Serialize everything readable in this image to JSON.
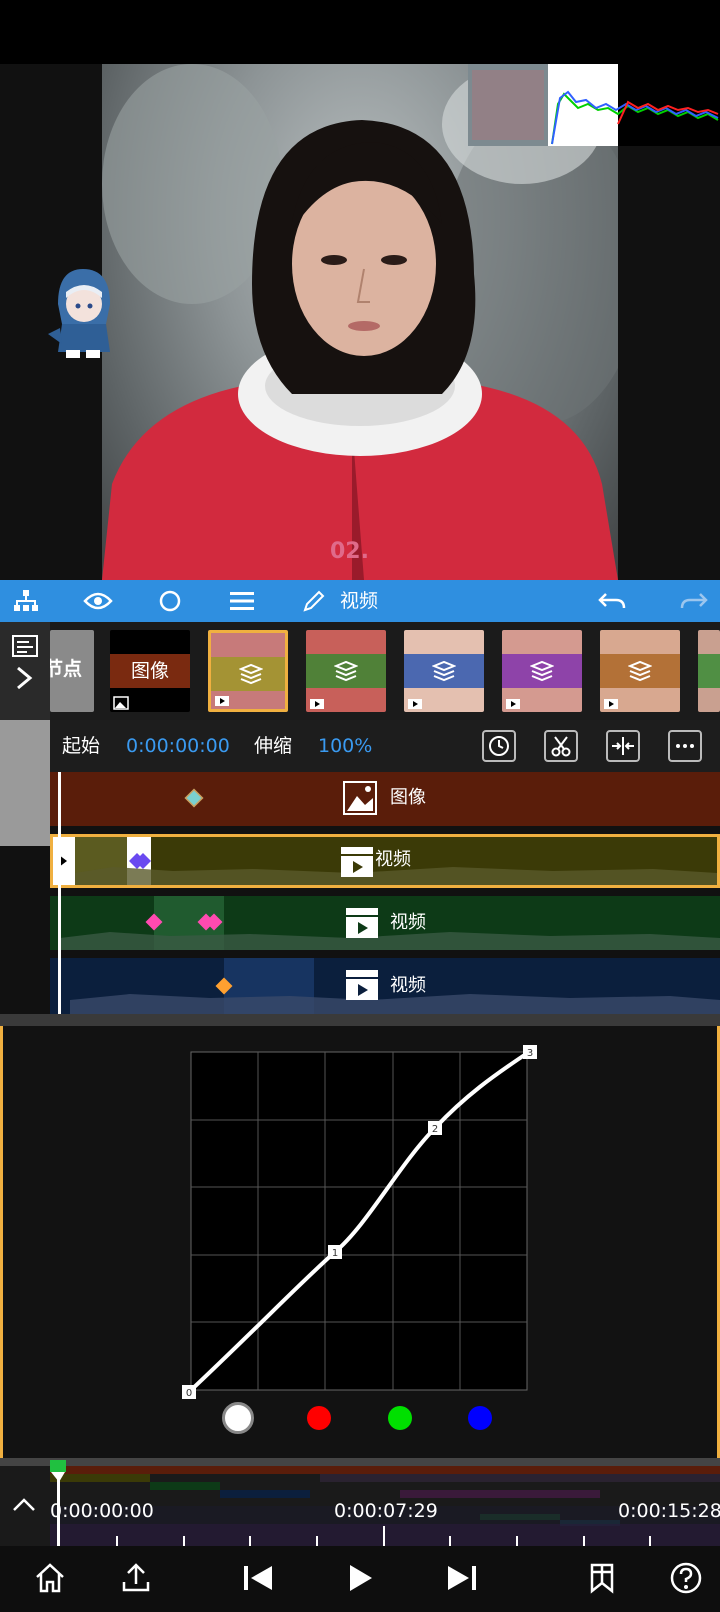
{
  "toolbar": {
    "title": "视频",
    "icons": [
      "layers-tree-icon",
      "eye-icon",
      "circle-icon",
      "menu-icon",
      "pencil-icon",
      "undo-icon",
      "redo-icon"
    ]
  },
  "preview": {
    "watermark": "02."
  },
  "strip": {
    "node_label": "节点",
    "image_label": "图像",
    "clip_colors": [
      "#c9c93a",
      "#2e9a2e",
      "#2050b0",
      "#8a2bb0",
      "#b06a20"
    ]
  },
  "clip_info": {
    "start_label": "起始",
    "start_value": "0:00:00:00",
    "speed_label": "伸缩",
    "speed_value": "100%"
  },
  "tracks": [
    {
      "label": "图像",
      "color": "#5a1d0a"
    },
    {
      "label": "视频",
      "color": "#3b3a07"
    },
    {
      "label": "视频",
      "color": "#0d3a17"
    },
    {
      "label": "视频",
      "color": "#0b1f3d"
    }
  ],
  "curve": {
    "points": [
      "0",
      "1",
      "2",
      "3"
    ]
  },
  "channels": [
    "#ffffff",
    "#ff0000",
    "#00e000",
    "#0000ff"
  ],
  "timeline": {
    "t0": "0:00:00:00",
    "t1": "0:00:07:29",
    "t2": "0:00:15:28"
  },
  "bottom_nav": [
    "home-icon",
    "share-icon",
    "skip-back-icon",
    "play-icon",
    "skip-forward-icon",
    "bookmark-icon",
    "help-icon"
  ]
}
